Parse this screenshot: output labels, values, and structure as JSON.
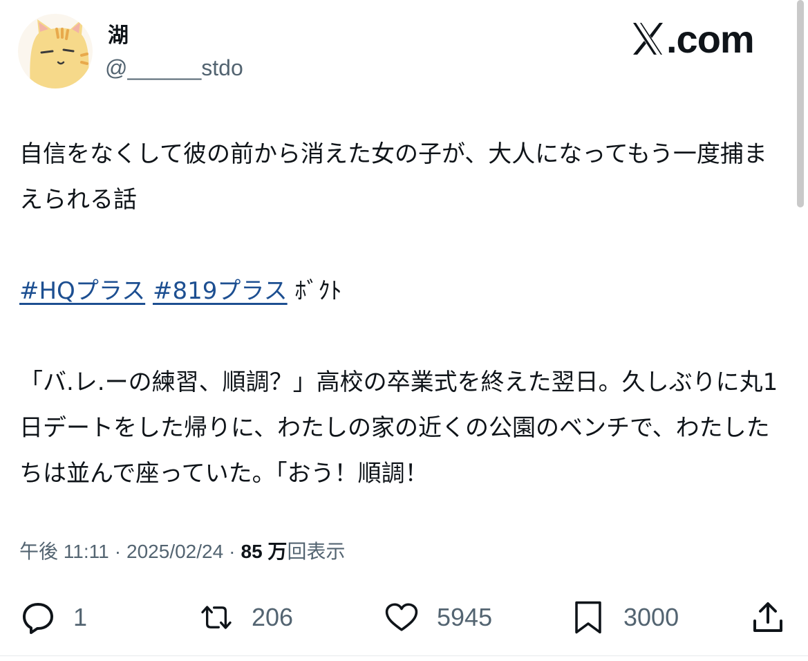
{
  "user": {
    "display_name": "湖",
    "handle": "@______stdo",
    "avatar_icon": "cat-avatar-icon"
  },
  "brand": {
    "text": ".com",
    "icon": "x-logo-icon"
  },
  "post": {
    "line1": "自信をなくして彼の前から消えた女の子が、大人になってもう一度捕まえられる話",
    "hashtags": [
      "#HQプラス",
      "#819プラス"
    ],
    "after_tags": "ﾎﾞｸﾄ",
    "line3": "「バ.レ.ーの練習、順調？」高校の卒業式を終えた翌日。久しぶりに丸1日デートをした帰りに、わたしの家の近くの公園のベンチで、わたしたちは並んで座っていた。「おう！順調！"
  },
  "meta": {
    "time": "午後 11:11",
    "separator": "·",
    "date": "2025/02/24",
    "views_count": "85 万",
    "views_label": "回表示"
  },
  "actions": {
    "reply": {
      "icon": "reply-icon",
      "count": "1"
    },
    "repost": {
      "icon": "repost-icon",
      "count": "206"
    },
    "like": {
      "icon": "heart-icon",
      "count": "5945"
    },
    "bookmark": {
      "icon": "bookmark-icon",
      "count": "3000"
    },
    "share": {
      "icon": "share-icon"
    }
  },
  "colors": {
    "hashtag": "#1d4f91",
    "secondary_text": "#536471",
    "text": "#0f1419"
  }
}
